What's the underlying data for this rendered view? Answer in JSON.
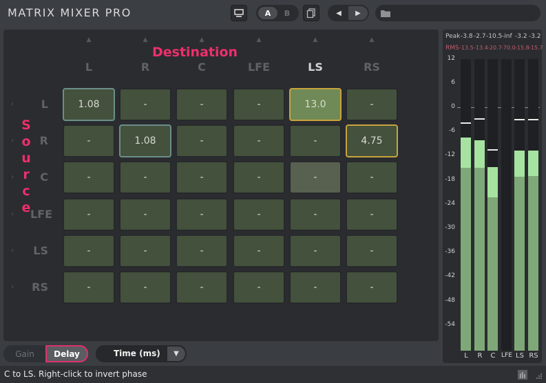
{
  "header": {
    "title": "MATRIX MIXER PRO",
    "preset_a": "A",
    "preset_b": "B",
    "preset_name": ""
  },
  "matrix": {
    "destination_label": "Destination",
    "source_label": [
      "S",
      "o",
      "u",
      "r",
      "c",
      "e"
    ],
    "columns": [
      "L",
      "R",
      "C",
      "LFE",
      "LS",
      "RS"
    ],
    "rows": [
      {
        "label": "L",
        "cells": [
          "1.08",
          "-",
          "-",
          "-",
          "13.0",
          "-"
        ]
      },
      {
        "label": "R",
        "cells": [
          "-",
          "1.08",
          "-",
          "-",
          "-",
          "4.75"
        ]
      },
      {
        "label": "C",
        "cells": [
          "-",
          "-",
          "-",
          "-",
          "-",
          "-"
        ]
      },
      {
        "label": "LFE",
        "cells": [
          "-",
          "-",
          "-",
          "-",
          "-",
          "-"
        ]
      },
      {
        "label": "LS",
        "cells": [
          "-",
          "-",
          "-",
          "-",
          "-",
          "-"
        ]
      },
      {
        "label": "RS",
        "cells": [
          "-",
          "-",
          "-",
          "-",
          "-",
          "-"
        ]
      }
    ]
  },
  "meter": {
    "peak_label": "Peak",
    "rms_label": "RMS",
    "peak_values": [
      "-3.8",
      "-2.7",
      "-10.5",
      "-inf",
      "-3.2",
      "-3.2"
    ],
    "rms_values": [
      "-13.5",
      "-13.4",
      "-20.7",
      "-70.0",
      "-15.8",
      "-15.7"
    ],
    "scale": [
      "12",
      "6",
      "0",
      "-6",
      "-12",
      "-18",
      "-24",
      "-30",
      "-36",
      "-42",
      "-48",
      "-54"
    ],
    "channels": [
      "L",
      "R",
      "C",
      "LFE",
      "LS",
      "RS"
    ],
    "accent_color": "#7fa878"
  },
  "controls": {
    "gain_label": "Gain",
    "delay_label": "Delay",
    "units_label": "Time (ms)"
  },
  "status": {
    "text": "C to LS. Right-click to invert phase"
  }
}
